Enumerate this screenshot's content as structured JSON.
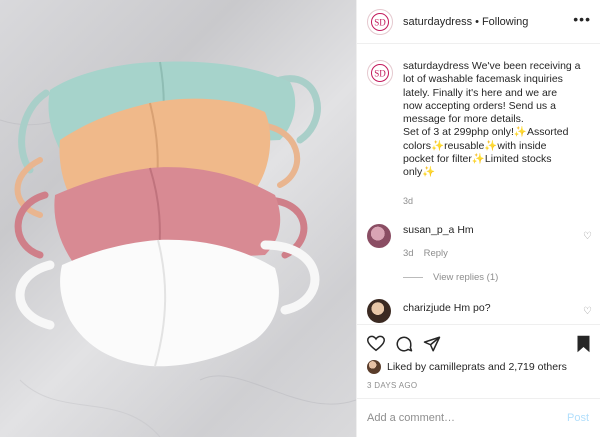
{
  "header": {
    "username": "saturdaydress",
    "separator": "•",
    "follow_status": "Following",
    "more_icon": "more-dots-icon"
  },
  "caption": {
    "username": "saturdaydress",
    "lines": [
      "We've been receiving a",
      "lot of washable facemask inquiries",
      "lately. Finally it's here and we are",
      "now accepting orders! Send us a",
      "message for more details.",
      "Set of 3 at 299php only!✨Assorted",
      "colors✨reusable✨with inside",
      "pocket for filter✨Limited stocks",
      "only✨"
    ],
    "time": "3d"
  },
  "comments": [
    {
      "username": "susan_p_a",
      "text": "Hm",
      "time": "3d",
      "reply_label": "Reply",
      "view_replies": "View replies (1)"
    },
    {
      "username": "charizjude",
      "text": "Hm po?"
    }
  ],
  "likes": {
    "prefix": "Liked by",
    "user": "camilleprats",
    "conj": "and",
    "others": "2,719 others"
  },
  "posted_ago": "3 DAYS AGO",
  "add_comment": {
    "placeholder": "Add a comment…",
    "post_label": "Post"
  },
  "colors": {
    "brand_pink": "#c2185b",
    "link_blue_disabled": "#b2dffc",
    "meta_gray": "#8e8e8e"
  }
}
